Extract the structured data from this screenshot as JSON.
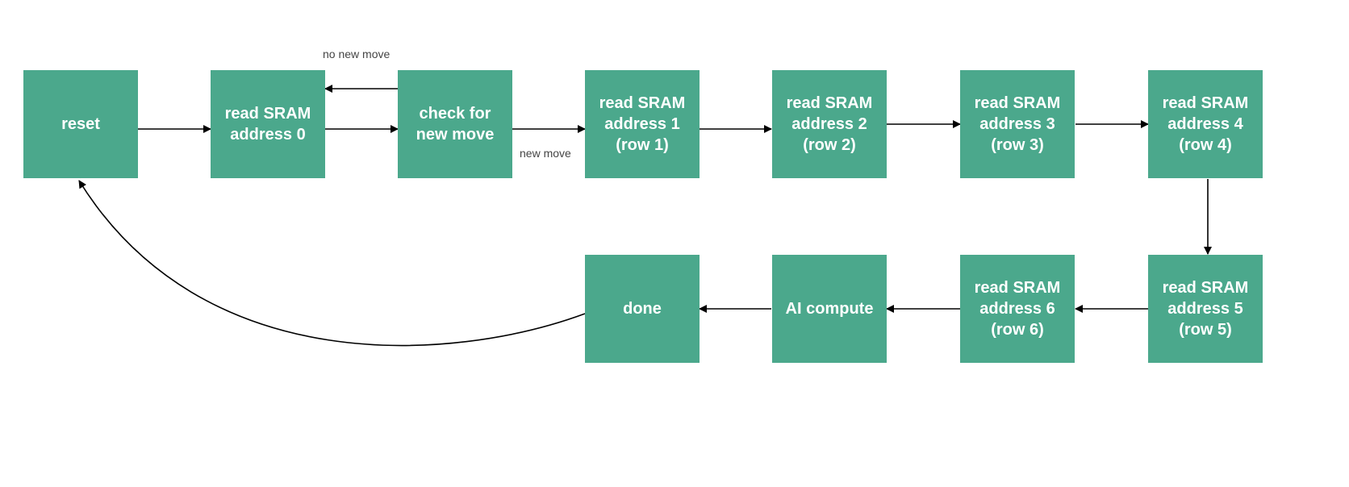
{
  "diagram": {
    "box_color": "#4BA88C",
    "nodes": [
      {
        "id": "reset",
        "label": "reset"
      },
      {
        "id": "addr0",
        "label": "read SRAM address 0"
      },
      {
        "id": "check",
        "label": "check for new move"
      },
      {
        "id": "addr1",
        "label": "read SRAM address 1 (row 1)"
      },
      {
        "id": "addr2",
        "label": "read SRAM address 2 (row 2)"
      },
      {
        "id": "addr3",
        "label": "read SRAM address 3 (row 3)"
      },
      {
        "id": "addr4",
        "label": "read SRAM address 4 (row 4)"
      },
      {
        "id": "addr5",
        "label": "read SRAM address 5 (row 5)"
      },
      {
        "id": "addr6",
        "label": "read SRAM address 6 (row 6)"
      },
      {
        "id": "ai",
        "label": "AI compute"
      },
      {
        "id": "done",
        "label": "done"
      }
    ],
    "edge_labels": {
      "no_new_move": "no new move",
      "new_move": "new move"
    },
    "edges": [
      {
        "from": "reset",
        "to": "addr0"
      },
      {
        "from": "addr0",
        "to": "check"
      },
      {
        "from": "check",
        "to": "addr0",
        "label": "no new move"
      },
      {
        "from": "check",
        "to": "addr1",
        "label": "new move"
      },
      {
        "from": "addr1",
        "to": "addr2"
      },
      {
        "from": "addr2",
        "to": "addr3"
      },
      {
        "from": "addr3",
        "to": "addr4"
      },
      {
        "from": "addr4",
        "to": "addr5"
      },
      {
        "from": "addr5",
        "to": "addr6"
      },
      {
        "from": "addr6",
        "to": "ai"
      },
      {
        "from": "ai",
        "to": "done"
      },
      {
        "from": "done",
        "to": "reset"
      }
    ]
  }
}
